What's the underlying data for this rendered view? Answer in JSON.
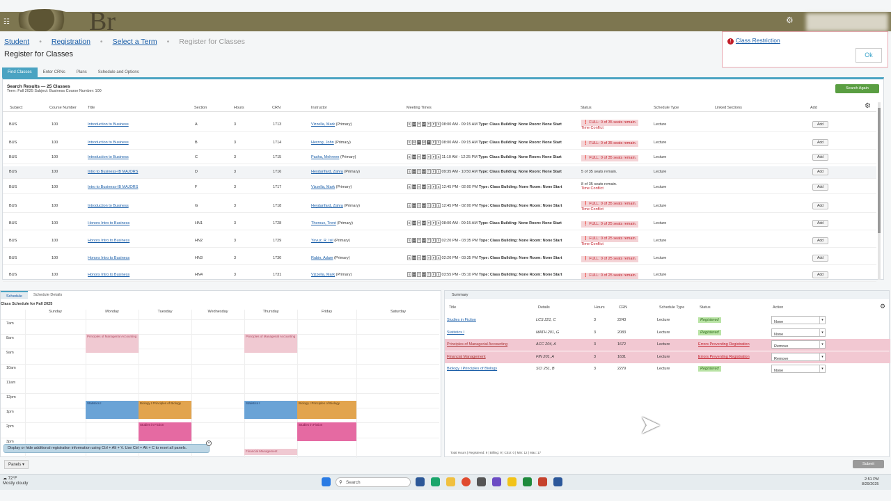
{
  "breadcrumbs": [
    "Student",
    "Registration",
    "Select a Term",
    "Register for Classes"
  ],
  "page_title": "Register for Classes",
  "logo_text": "Br",
  "tabs": [
    "Find Classes",
    "Enter CRNs",
    "Plans",
    "Schedule and Options"
  ],
  "notification": {
    "message": "Class Restriction",
    "ok_label": "Ok"
  },
  "search_results": {
    "title": "Search Results — 25 Classes",
    "subtitle": "Term: Fall 2025    Subject: Business    Course Number: 100",
    "search_again_label": "Search Again",
    "columns": [
      "Subject",
      "Course Number",
      "Title",
      "Section",
      "Hours",
      "CRN",
      "Instructor",
      "Meeting Times",
      "Status",
      "Schedule Type",
      "Linked Sections",
      "Add"
    ],
    "rows": [
      {
        "subject": "BUS",
        "course": "100",
        "title": "Introduction to Business",
        "section": "A",
        "hours": "3",
        "crn": "1713",
        "instructor": "Vizzella, Mark",
        "instr_role": "(Primary)",
        "days": "MW",
        "time": "08:00 AM - 09:15 AM",
        "status1": "FULL: 0 of 35 seats remain.",
        "status2": "Time Conflict",
        "full": true,
        "type": "Lecture",
        "add": "Add"
      },
      {
        "subject": "BUS",
        "course": "100",
        "title": "Introduction to Business",
        "section": "B",
        "hours": "3",
        "crn": "1714",
        "instructor": "Herzog, John",
        "instr_role": "(Primary)",
        "days": "TR",
        "time": "08:00 AM - 09:15 AM",
        "status1": "FULL: 0 of 35 seats remain.",
        "status2": "",
        "full": true,
        "type": "Lecture",
        "add": "Add"
      },
      {
        "subject": "BUS",
        "course": "100",
        "title": "Introduction to Business",
        "section": "C",
        "hours": "3",
        "crn": "1715",
        "instructor": "Pasha, Mehreen",
        "instr_role": "(Primary)",
        "days": "MW",
        "time": "11:10 AM - 12:25 PM",
        "status1": "FULL: 0 of 35 seats remain.",
        "status2": "",
        "full": true,
        "type": "Lecture",
        "add": "Add"
      },
      {
        "subject": "BUS",
        "course": "100",
        "title": "Intro to Business-IB MAJORS",
        "section": "D",
        "hours": "3",
        "crn": "1716",
        "instructor": "Heydarifard, Zahra",
        "instr_role": "(Primary)",
        "days": "MW",
        "time": "09:35 AM - 10:50 AM",
        "status1": "5 of 35 seats remain.",
        "status2": "",
        "full": false,
        "type": "Lecture",
        "add": "Add"
      },
      {
        "subject": "BUS",
        "course": "100",
        "title": "Intro to Business-IB MAJORS",
        "section": "F",
        "hours": "3",
        "crn": "1717",
        "instructor": "Vizzella, Mark",
        "instr_role": "(Primary)",
        "days": "MW",
        "time": "12:45 PM - 02:00 PM",
        "status1": "8 of 35 seats remain.",
        "status2": "Time Conflict",
        "full": false,
        "type": "Lecture",
        "add": "Add"
      },
      {
        "subject": "BUS",
        "course": "100",
        "title": "Introduction to Business",
        "section": "G",
        "hours": "3",
        "crn": "1718",
        "instructor": "Heydarifard, Zahra",
        "instr_role": "(Primary)",
        "days": "MW",
        "time": "12:45 PM - 02:00 PM",
        "status1": "FULL: 0 of 35 seats remain.",
        "status2": "Time Conflict",
        "full": true,
        "type": "Lecture",
        "add": "Add"
      },
      {
        "subject": "BUS",
        "course": "100",
        "title": "Honors Intro to Business",
        "section": "HN1",
        "hours": "3",
        "crn": "1728",
        "instructor": "Theroux, Trent",
        "instr_role": "(Primary)",
        "days": "MW",
        "time": "08:00 AM - 09:15 AM",
        "status1": "FULL: 0 of 25 seats remain.",
        "status2": "",
        "full": true,
        "type": "Lecture",
        "add": "Add"
      },
      {
        "subject": "BUS",
        "course": "100",
        "title": "Honors Intro to Business",
        "section": "HN2",
        "hours": "3",
        "crn": "1729",
        "instructor": "Yavuz, R. Isil",
        "instr_role": "(Primary)",
        "days": "MW",
        "time": "02:20 PM - 03:35 PM",
        "status1": "FULL: 0 of 25 seats remain.",
        "status2": "Time Conflict",
        "full": true,
        "type": "Lecture",
        "add": "Add"
      },
      {
        "subject": "BUS",
        "course": "100",
        "title": "Honors Intro to Business",
        "section": "HN3",
        "hours": "3",
        "crn": "1730",
        "instructor": "Rubin, Adam",
        "instr_role": "(Primary)",
        "days": "MW",
        "time": "02:20 PM - 03:35 PM",
        "status1": "FULL: 0 of 25 seats remain.",
        "status2": "",
        "full": true,
        "type": "Lecture",
        "add": "Add"
      },
      {
        "subject": "BUS",
        "course": "100",
        "title": "Honors Intro to Business",
        "section": "HN4",
        "hours": "3",
        "crn": "1731",
        "instructor": "Vizzella, Mark",
        "instr_role": "(Primary)",
        "days": "MW",
        "time": "03:55 PM - 05:10 PM",
        "status1": "FULL: 0 of 25 seats remain.",
        "status2": "",
        "full": true,
        "type": "Lecture",
        "add": "Add"
      }
    ],
    "meeting_labels": {
      "type": "Type: Class",
      "building": "Building: None",
      "room": "Room: None",
      "start": "Start"
    }
  },
  "schedule": {
    "tabs": [
      "Schedule",
      "Schedule Details"
    ],
    "title": "Class Schedule for Fall 2025",
    "days": [
      "Sunday",
      "Monday",
      "Tuesday",
      "Wednesday",
      "Thursday",
      "Friday",
      "Saturday"
    ],
    "hours": [
      "7am",
      "8am",
      "9am",
      "10am",
      "11am",
      "12pm",
      "1pm",
      "2pm",
      "3pm"
    ],
    "events": [
      {
        "label": "Principles of Managerial Accounting",
        "color": "pink",
        "day": 1,
        "start": 8.0,
        "end": 9.25
      },
      {
        "label": "Principles of Managerial Accounting",
        "color": "pink",
        "day": 4,
        "start": 8.0,
        "end": 9.25
      },
      {
        "label": "Statistics I",
        "color": "blue",
        "day": 1,
        "start": 12.5,
        "end": 13.75
      },
      {
        "label": "Statistics I",
        "color": "blue",
        "day": 4,
        "start": 12.5,
        "end": 13.75
      },
      {
        "label": "Biology I Principles of Biology",
        "color": "orange",
        "day": 2,
        "start": 12.5,
        "end": 13.75
      },
      {
        "label": "Biology I Principles of Biology",
        "color": "orange",
        "day": 5,
        "start": 12.5,
        "end": 13.75
      },
      {
        "label": "Studies in Fiction",
        "color": "magenta",
        "day": 2,
        "start": 14.0,
        "end": 15.25
      },
      {
        "label": "Studies in Fiction",
        "color": "magenta",
        "day": 5,
        "start": 14.0,
        "end": 15.25
      },
      {
        "label": "Financial Management",
        "color": "pink",
        "day": 4,
        "start": 15.75,
        "end": 16.2
      }
    ],
    "tip": "Display or hide additional registration information using Ctrl + Alt + V. Use Ctrl + Alt + C to reset all panels.",
    "panels_label": "Panels"
  },
  "summary": {
    "title": "Summary",
    "columns": [
      "Title",
      "Details",
      "Hours",
      "CRN",
      "Schedule Type",
      "Status",
      "Action"
    ],
    "rows": [
      {
        "title": "Studies in Fiction",
        "details": "LCS 221, C",
        "hours": "3",
        "crn": "2243",
        "type": "Lecture",
        "status": "Registered",
        "error": false,
        "action": "None"
      },
      {
        "title": "Statistics I",
        "details": "MATH 201, G",
        "hours": "3",
        "crn": "2083",
        "type": "Lecture",
        "status": "Registered",
        "error": false,
        "action": "None"
      },
      {
        "title": "Principles of Managerial Accounting",
        "details": "ACC 204, A",
        "hours": "3",
        "crn": "1672",
        "type": "Lecture",
        "status": "Errors Preventing Registration",
        "error": true,
        "action": "Remove"
      },
      {
        "title": "Financial Management",
        "details": "FIN 201, A",
        "hours": "3",
        "crn": "1631",
        "type": "Lecture",
        "status": "Errors Preventing Registration",
        "error": true,
        "action": "Remove"
      },
      {
        "title": "Biology I Principles of Biology",
        "details": "SCI 251, B",
        "hours": "3",
        "crn": "2279",
        "type": "Lecture",
        "status": "Registered",
        "error": false,
        "action": "None"
      }
    ],
    "totals": "Total Hours | Registered: 9 | Billing: 9 | CEU: 0 | Min: 12 | Max: 17",
    "submit_label": "Submit"
  },
  "taskbar": {
    "weather_temp": "72°F",
    "weather_desc": "Mostly cloudy",
    "search_placeholder": "Search",
    "time": "2:51 PM",
    "date": "8/29/2025"
  }
}
